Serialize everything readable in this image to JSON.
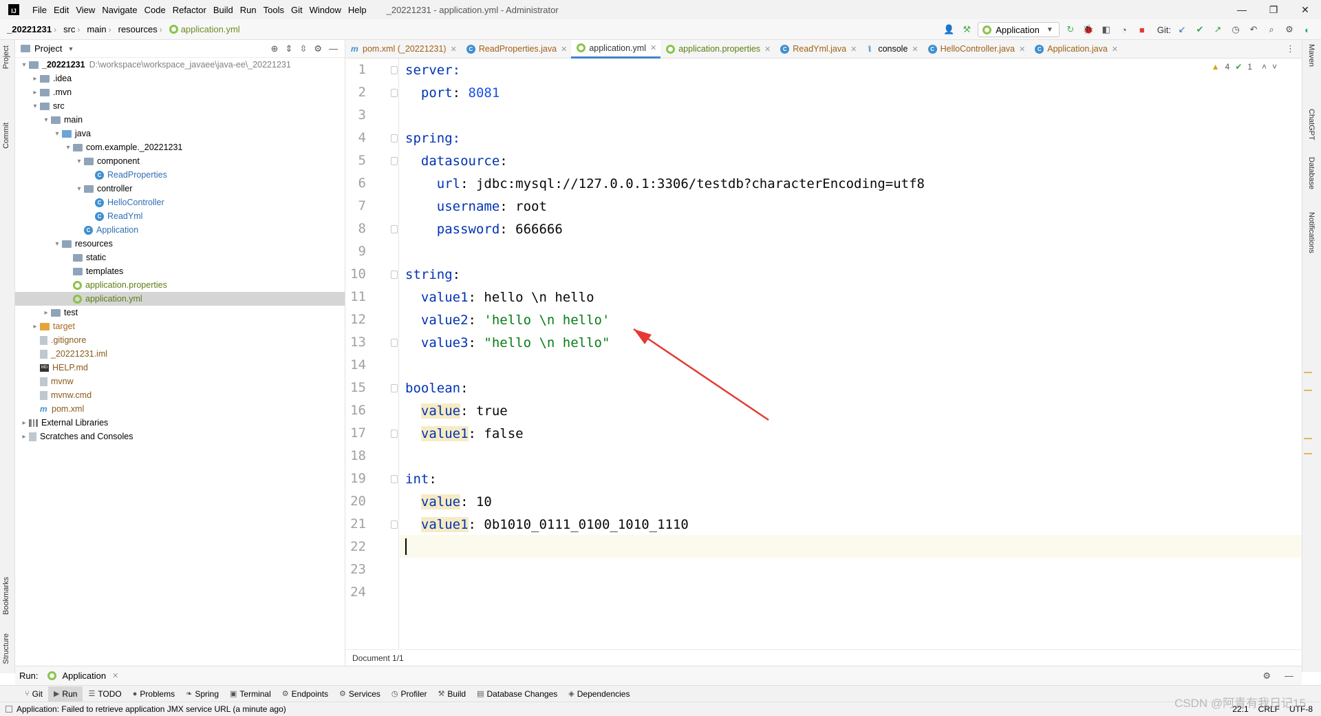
{
  "titlebar": {
    "logo": "IJ",
    "menu": [
      "File",
      "Edit",
      "View",
      "Navigate",
      "Code",
      "Refactor",
      "Build",
      "Run",
      "Tools",
      "Git",
      "Window",
      "Help"
    ],
    "window_title": "_20221231 - application.yml - Administrator",
    "controls": [
      "—",
      "❐",
      "✕"
    ]
  },
  "navbar": {
    "crumbs": [
      "_20221231",
      "src",
      "main",
      "resources",
      "application.yml"
    ],
    "run_config": "Application",
    "git_label": "Git:"
  },
  "left_strip": [
    "Project",
    "Commit",
    "Bookmarks",
    "Structure"
  ],
  "right_strip": [
    "Maven",
    "ChatGPT",
    "Database",
    "Notifications"
  ],
  "project": {
    "header": "Project",
    "tree": [
      {
        "label": "_20221231",
        "path": "D:\\workspace\\workspace_javaee\\java-ee\\_20221231",
        "depth": 0,
        "arrow": "▾",
        "icon": "folder",
        "style": "bold"
      },
      {
        "label": ".idea",
        "depth": 1,
        "arrow": "▸",
        "icon": "folder"
      },
      {
        "label": ".mvn",
        "depth": 1,
        "arrow": "▸",
        "icon": "folder"
      },
      {
        "label": "src",
        "depth": 1,
        "arrow": "▾",
        "icon": "folder"
      },
      {
        "label": "main",
        "depth": 2,
        "arrow": "▾",
        "icon": "folder"
      },
      {
        "label": "java",
        "depth": 3,
        "arrow": "▾",
        "icon": "folder-blue"
      },
      {
        "label": "com.example._20221231",
        "depth": 4,
        "arrow": "▾",
        "icon": "folder"
      },
      {
        "label": "component",
        "depth": 5,
        "arrow": "▾",
        "icon": "folder"
      },
      {
        "label": "ReadProperties",
        "depth": 6,
        "arrow": "",
        "icon": "class",
        "style": "blue"
      },
      {
        "label": "controller",
        "depth": 5,
        "arrow": "▾",
        "icon": "folder"
      },
      {
        "label": "HelloController",
        "depth": 6,
        "arrow": "",
        "icon": "class",
        "style": "blue"
      },
      {
        "label": "ReadYml",
        "depth": 6,
        "arrow": "",
        "icon": "class",
        "style": "blue"
      },
      {
        "label": "Application",
        "depth": 5,
        "arrow": "",
        "icon": "class",
        "style": "blue"
      },
      {
        "label": "resources",
        "depth": 3,
        "arrow": "▾",
        "icon": "folder-res"
      },
      {
        "label": "static",
        "depth": 4,
        "arrow": "",
        "icon": "folder"
      },
      {
        "label": "templates",
        "depth": 4,
        "arrow": "",
        "icon": "folder"
      },
      {
        "label": "application.properties",
        "depth": 4,
        "arrow": "",
        "icon": "yml",
        "style": "green"
      },
      {
        "label": "application.yml",
        "depth": 4,
        "arrow": "",
        "icon": "yml",
        "style": "green",
        "selected": true
      },
      {
        "label": "test",
        "depth": 2,
        "arrow": "▸",
        "icon": "folder"
      },
      {
        "label": "target",
        "depth": 1,
        "arrow": "▸",
        "icon": "folder-orange",
        "style": "orange"
      },
      {
        "label": ".gitignore",
        "depth": 1,
        "arrow": "",
        "icon": "file",
        "style": "brown"
      },
      {
        "label": "_20221231.iml",
        "depth": 1,
        "arrow": "",
        "icon": "file",
        "style": "brown"
      },
      {
        "label": "HELP.md",
        "depth": 1,
        "arrow": "",
        "icon": "md",
        "style": "brown"
      },
      {
        "label": "mvnw",
        "depth": 1,
        "arrow": "",
        "icon": "file",
        "style": "brown"
      },
      {
        "label": "mvnw.cmd",
        "depth": 1,
        "arrow": "",
        "icon": "file",
        "style": "brown"
      },
      {
        "label": "pom.xml",
        "depth": 1,
        "arrow": "",
        "icon": "m",
        "style": "brown"
      },
      {
        "label": "External Libraries",
        "depth": 0,
        "arrow": "▸",
        "icon": "lib"
      },
      {
        "label": "Scratches and Consoles",
        "depth": 0,
        "arrow": "▸",
        "icon": "file"
      }
    ]
  },
  "tabs": [
    {
      "label": "pom.xml (_20221231)",
      "icon": "m",
      "kind": "pom"
    },
    {
      "label": "ReadProperties.java",
      "icon": "class",
      "kind": "java"
    },
    {
      "label": "application.yml",
      "icon": "yml",
      "kind": "active"
    },
    {
      "label": "application.properties",
      "icon": "yml",
      "kind": "props"
    },
    {
      "label": "ReadYml.java",
      "icon": "class",
      "kind": "java"
    },
    {
      "label": "console",
      "icon": "console",
      "kind": "plain"
    },
    {
      "label": "HelloController.java",
      "icon": "class",
      "kind": "java"
    },
    {
      "label": "Application.java",
      "icon": "class",
      "kind": "java"
    }
  ],
  "inspections": {
    "warnings": "4",
    "ok": "1"
  },
  "editor": {
    "lines": [
      {
        "n": "1",
        "parts": [
          {
            "t": "server",
            "c": "k1"
          },
          {
            "t": ":",
            "c": "k1"
          }
        ],
        "fold": true
      },
      {
        "n": "2",
        "parts": [
          {
            "t": "  port",
            "c": "k2"
          },
          {
            "t": ": ",
            "c": "plain"
          },
          {
            "t": "8081",
            "c": "num"
          }
        ],
        "fold": true
      },
      {
        "n": "3",
        "parts": []
      },
      {
        "n": "4",
        "parts": [
          {
            "t": "spring",
            "c": "k1"
          },
          {
            "t": ":",
            "c": "k1"
          }
        ],
        "fold": true
      },
      {
        "n": "5",
        "parts": [
          {
            "t": "  datasource",
            "c": "k2"
          },
          {
            "t": ":",
            "c": "plain"
          }
        ],
        "fold": true
      },
      {
        "n": "6",
        "parts": [
          {
            "t": "    url",
            "c": "k2"
          },
          {
            "t": ": jdbc:mysql://127.0.0.1:3306/testdb?characterEncoding=utf8",
            "c": "plain"
          }
        ]
      },
      {
        "n": "7",
        "parts": [
          {
            "t": "    username",
            "c": "k2"
          },
          {
            "t": ": root",
            "c": "plain"
          }
        ]
      },
      {
        "n": "8",
        "parts": [
          {
            "t": "    password",
            "c": "k2"
          },
          {
            "t": ": 666666",
            "c": "plain"
          }
        ],
        "fold": true
      },
      {
        "n": "9",
        "parts": []
      },
      {
        "n": "10",
        "parts": [
          {
            "t": "string",
            "c": "k1"
          },
          {
            "t": ":",
            "c": "plain"
          }
        ],
        "fold": true
      },
      {
        "n": "11",
        "parts": [
          {
            "t": "  value1",
            "c": "k2"
          },
          {
            "t": ": hello \\n hello",
            "c": "plain"
          }
        ]
      },
      {
        "n": "12",
        "parts": [
          {
            "t": "  value2",
            "c": "k2"
          },
          {
            "t": ": ",
            "c": "plain"
          },
          {
            "t": "'hello \\n hello'",
            "c": "str"
          }
        ]
      },
      {
        "n": "13",
        "parts": [
          {
            "t": "  value3",
            "c": "k2"
          },
          {
            "t": ": ",
            "c": "plain"
          },
          {
            "t": "\"hello \\n hello\"",
            "c": "str"
          }
        ],
        "fold": true
      },
      {
        "n": "14",
        "parts": []
      },
      {
        "n": "15",
        "parts": [
          {
            "t": "boolean",
            "c": "k1"
          },
          {
            "t": ":",
            "c": "plain"
          }
        ],
        "fold": true
      },
      {
        "n": "16",
        "parts": [
          {
            "t": "  ",
            "c": "plain"
          },
          {
            "t": "value",
            "c": "k2 hl-key"
          },
          {
            "t": ": true",
            "c": "plain"
          }
        ]
      },
      {
        "n": "17",
        "parts": [
          {
            "t": "  ",
            "c": "plain"
          },
          {
            "t": "value1",
            "c": "k2 hl-key"
          },
          {
            "t": ": false",
            "c": "plain"
          }
        ],
        "fold": true
      },
      {
        "n": "18",
        "parts": []
      },
      {
        "n": "19",
        "parts": [
          {
            "t": "int",
            "c": "k1"
          },
          {
            "t": ":",
            "c": "plain"
          }
        ],
        "fold": true
      },
      {
        "n": "20",
        "parts": [
          {
            "t": "  ",
            "c": "plain"
          },
          {
            "t": "value",
            "c": "k2 hl-key"
          },
          {
            "t": ": 10",
            "c": "plain"
          }
        ]
      },
      {
        "n": "21",
        "parts": [
          {
            "t": "  ",
            "c": "plain"
          },
          {
            "t": "value1",
            "c": "k2 hl-key"
          },
          {
            "t": ": 0b1010_0111_0100_1010_1110",
            "c": "plain"
          }
        ],
        "fold": true
      },
      {
        "n": "22",
        "parts": []
      },
      {
        "n": "23",
        "parts": []
      },
      {
        "n": "24",
        "parts": []
      }
    ],
    "document_crumb": "Document 1/1"
  },
  "run_panel": {
    "label": "Run:",
    "tab": "Application"
  },
  "bottom_tools": [
    {
      "label": "Git",
      "icon": "⑂"
    },
    {
      "label": "Run",
      "icon": "▶",
      "active": true
    },
    {
      "label": "TODO",
      "icon": "☰"
    },
    {
      "label": "Problems",
      "icon": "●"
    },
    {
      "label": "Spring",
      "icon": "❧"
    },
    {
      "label": "Terminal",
      "icon": "▣"
    },
    {
      "label": "Endpoints",
      "icon": "⚙"
    },
    {
      "label": "Services",
      "icon": "⚙"
    },
    {
      "label": "Profiler",
      "icon": "◷"
    },
    {
      "label": "Build",
      "icon": "⚒"
    },
    {
      "label": "Database Changes",
      "icon": "▤"
    },
    {
      "label": "Dependencies",
      "icon": "◈"
    }
  ],
  "status": {
    "message": "Application: Failed to retrieve application JMX service URL (a minute ago)",
    "position": "22:1",
    "line_sep": "CRLF",
    "encoding": "UTF-8"
  },
  "watermark": "CSDN @阿青有我日记15",
  "colors": {
    "accent": "#4083c9",
    "arrow": "#e53935",
    "keyword": "#0033b3",
    "string": "#067d17"
  }
}
